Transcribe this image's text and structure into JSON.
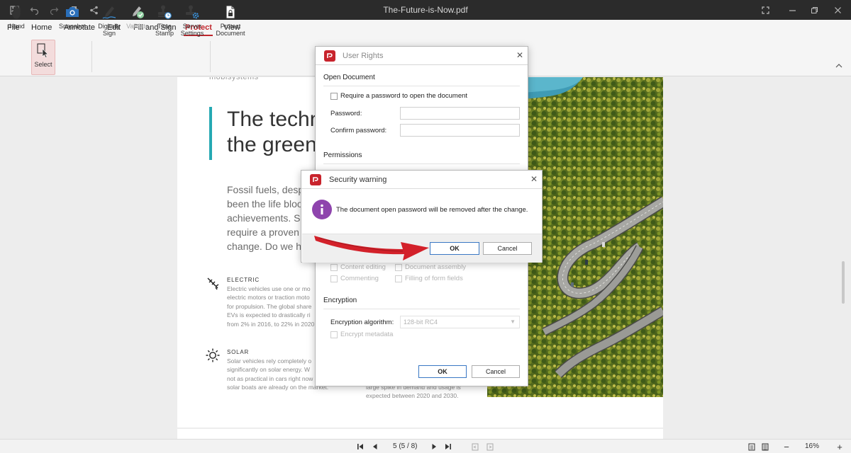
{
  "window": {
    "title": "The-Future-is-Now.pdf",
    "quick_access_icons": [
      "save-icon",
      "undo-icon",
      "redo-icon",
      "print-icon",
      "share-icon"
    ],
    "controls": [
      "fullscreen-icon",
      "minimize-icon",
      "restore-icon",
      "close-icon"
    ]
  },
  "menu": {
    "items": [
      "File",
      "Home",
      "Annotate",
      "Edit",
      "Fill and Sign",
      "Protect",
      "View"
    ],
    "active": "Protect",
    "accent_color": "#c0262d"
  },
  "ribbon": {
    "hand": "Hand",
    "select": "Select",
    "snapshot": "Snapshot",
    "digitally_sign": "Digitally\nSign",
    "validate": "Validate",
    "time_stamp": "Time\nStamp",
    "server_settings": "Server\nSettings",
    "protect_document": "Protect\nDocument"
  },
  "document": {
    "brand": "mobisystems",
    "headline": "The techn\nthe green",
    "intro": "Fossil fuels, despi\nbeen the life blood\nachievements. Sh\nrequire a proven t\nchange. Do we ha",
    "electric_heading": "ELECTRIC",
    "electric_body": "Electric vehicles use one or mo\nelectric motors or traction moto\nfor propulsion. The global share\nEVs is expected to drastically ri\nfrom 2% in 2016, to 22% in 2020",
    "solar_heading": "SOLAR",
    "solar_body": "Solar vehicles rely completely o\nsignificantly on solar energy. W\nnot as practical in cars right now\nsolar boats are already on the market.",
    "right_col_body": "large spike in demand and usage is\nexpected between 2020 and 2030.",
    "accent_color": "#26a9b3"
  },
  "user_rights_dialog": {
    "title": "User Rights",
    "open_document_label": "Open Document",
    "require_password_label": "Require a password to open the document",
    "password_label": "Password:",
    "confirm_password_label": "Confirm password:",
    "permissions_label": "Permissions",
    "content_editing": "Content editing",
    "document_assembly": "Document assembly",
    "commenting": "Commenting",
    "filling_form_fields": "Filling of form fields",
    "encryption_label": "Encryption",
    "encryption_algorithm_label": "Encryption algorithm:",
    "encryption_algorithm_value": "128-bit RC4",
    "encrypt_metadata": "Encrypt metadata",
    "ok": "OK",
    "cancel": "Cancel"
  },
  "security_warning_dialog": {
    "title": "Security warning",
    "message": "The document open password will be removed after the change.",
    "ok": "OK",
    "cancel": "Cancel",
    "info_icon_color": "#8e44ad"
  },
  "statusbar": {
    "page_indicator": "5 (5 / 8)",
    "zoom": "16%"
  }
}
